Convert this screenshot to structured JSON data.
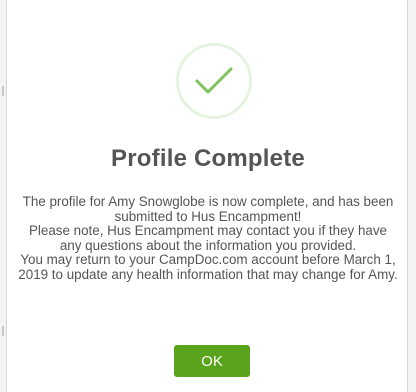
{
  "dialog": {
    "title": "Profile Complete",
    "message_lines": [
      "The profile for Amy Snowglobe is now complete, and has been submitted to Hus Encampment!",
      "Please note, Hus Encampment may contact you if they have any questions about the information you provided.",
      "You may return to your CampDoc.com account before March 1, 2019 to update any health information that may change for Amy."
    ],
    "ok_label": "OK",
    "icon": "checkmark-icon",
    "colors": {
      "accent": "#5aa31d",
      "icon_ring": "#e6f3e0",
      "icon_check": "#7cc35c",
      "text": "#555555"
    }
  }
}
